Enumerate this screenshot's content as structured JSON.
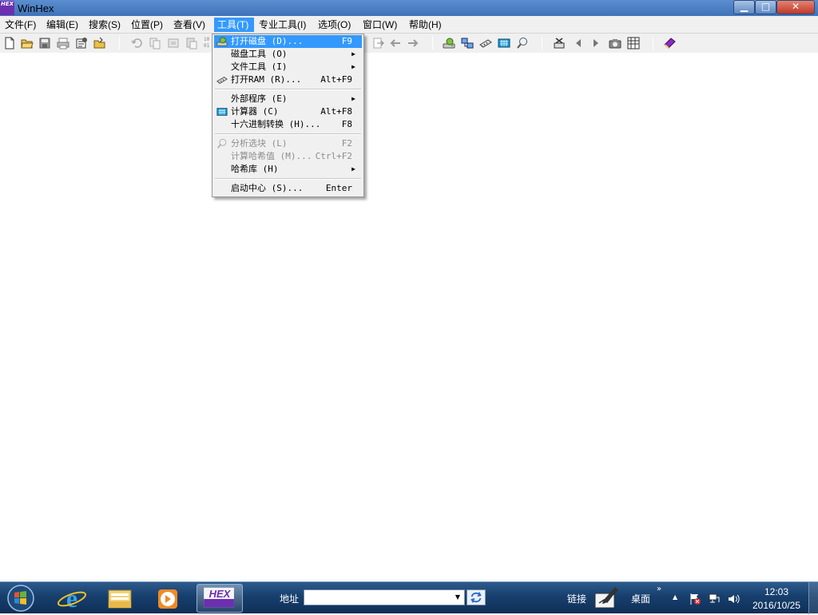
{
  "window": {
    "title": "WinHex",
    "logo_text": "HEX",
    "controls": {
      "minimize": "▁",
      "maximize": "□",
      "close": "✕"
    }
  },
  "menubar": {
    "items": [
      {
        "label": "文件(F)"
      },
      {
        "label": "编辑(E)"
      },
      {
        "label": "搜索(S)"
      },
      {
        "label": "位置(P)"
      },
      {
        "label": "查看(V)"
      },
      {
        "label": "工具(T)",
        "active": true
      },
      {
        "label": "专业工具(I)"
      },
      {
        "label": "选项(O)"
      },
      {
        "label": "窗口(W)"
      },
      {
        "label": "帮助(H)"
      }
    ]
  },
  "toolbar": {
    "icons": [
      "new-file-icon",
      "open-folder-icon",
      "save-icon",
      "print-icon",
      "properties-icon",
      "open-folder-icon-2",
      "undo-icon",
      "copy-icon",
      "cut-icon",
      "paste-icon",
      "binary-icon",
      "goto-icon",
      "back-icon",
      "forward-icon",
      "disk-icon",
      "network-icon",
      "ram-icon",
      "calculator-icon",
      "search-icon",
      "tools-icon",
      "previous-icon",
      "next-icon",
      "camera-icon",
      "grid-icon",
      "book-icon"
    ],
    "binary_text": "10 01"
  },
  "tools_menu": {
    "items": [
      {
        "label": "打开磁盘 (D)...",
        "shortcut": "F9",
        "icon": "disk-icon",
        "highlight": true
      },
      {
        "label": "磁盘工具 (O)",
        "submenu": true
      },
      {
        "label": "文件工具 (I)",
        "submenu": true
      },
      {
        "label": "打开RAM (R)...",
        "shortcut": "Alt+F9",
        "icon": "ram-icon"
      },
      {
        "separator": true
      },
      {
        "label": "外部程序 (E)",
        "submenu": true
      },
      {
        "label": "计算器 (C)",
        "shortcut": "Alt+F8",
        "icon": "calculator-icon"
      },
      {
        "label": "十六进制转换 (H)...",
        "shortcut": "F8"
      },
      {
        "separator": true
      },
      {
        "label": "分析选块 (L)",
        "shortcut": "F2",
        "icon": "search-icon",
        "disabled": true
      },
      {
        "label": "计算哈希值 (M)...",
        "shortcut": "Ctrl+F2",
        "disabled": true
      },
      {
        "label": "哈希库 (H)",
        "submenu": true
      },
      {
        "separator": true
      },
      {
        "label": "启动中心 (S)...",
        "shortcut": "Enter"
      }
    ]
  },
  "taskbar": {
    "address_label": "地址",
    "address_value": "",
    "links_label": "链接",
    "desktop_label": "桌面",
    "time": "12:03",
    "date": "2016/10/25",
    "apps": [
      "internet-explorer-icon",
      "file-explorer-icon",
      "media-player-icon",
      "winhex-icon"
    ],
    "winhex_label": "HEX"
  }
}
